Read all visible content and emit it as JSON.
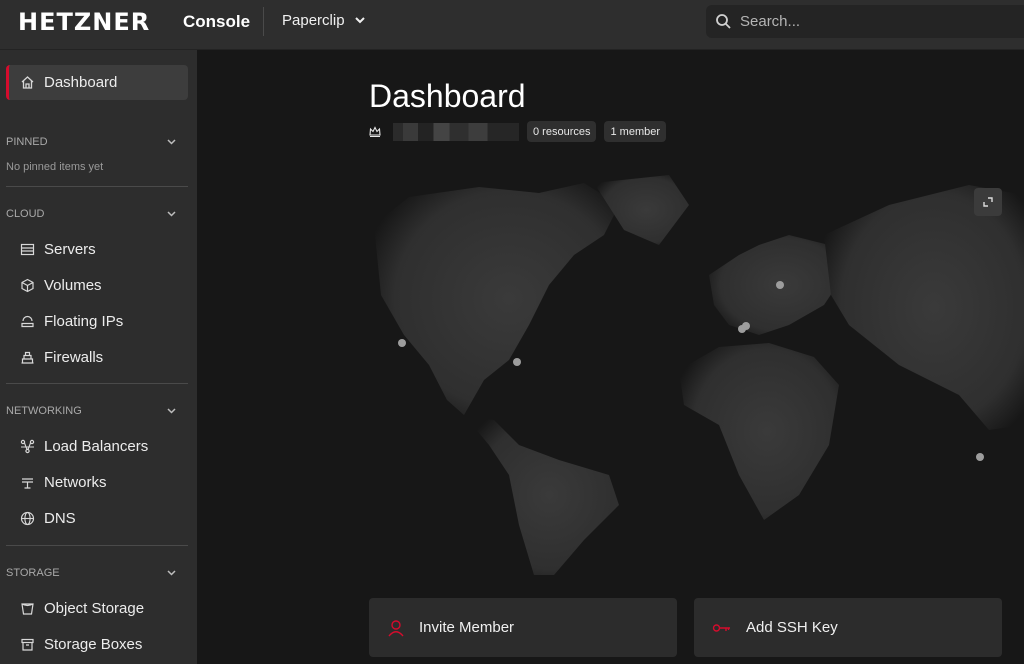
{
  "header": {
    "logo_text": "HETZNER",
    "console_label": "Console",
    "project_name": "Paperclip",
    "search_placeholder": "Search..."
  },
  "sidebar": {
    "dashboard_label": "Dashboard",
    "pinned": {
      "title": "PINNED",
      "empty_text": "No pinned items yet"
    },
    "cloud": {
      "title": "CLOUD",
      "items": [
        "Servers",
        "Volumes",
        "Floating IPs",
        "Firewalls"
      ]
    },
    "networking": {
      "title": "NETWORKING",
      "items": [
        "Load Balancers",
        "Networks",
        "DNS"
      ]
    },
    "storage": {
      "title": "STORAGE",
      "items": [
        "Object Storage",
        "Storage Boxes"
      ]
    }
  },
  "main": {
    "title": "Dashboard",
    "resources_badge": "0 resources",
    "members_badge": "1 member",
    "map_locations": [
      "us-west",
      "us-east",
      "eu-north",
      "eu-central-1",
      "eu-central-2",
      "ap-southeast"
    ],
    "actions": [
      "Invite Member",
      "Add SSH Key"
    ]
  },
  "colors": {
    "accent": "#d50c2d",
    "sidebar_bg": "#2d2d2d",
    "topbar_bg": "#2e2e2e",
    "main_bg": "#171717"
  }
}
